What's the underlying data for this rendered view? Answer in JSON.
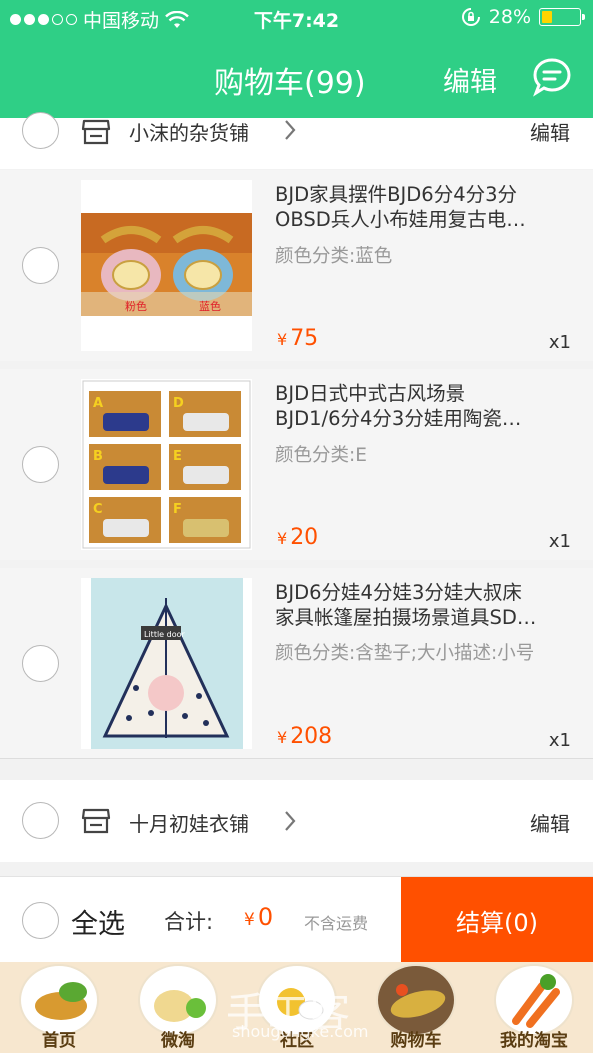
{
  "status": {
    "carrier": "中国移动",
    "time": "下午7:42",
    "battery": "28%",
    "battery_level": 0.28,
    "signal_full": 3,
    "signal_total": 5
  },
  "nav": {
    "title": "购物车(99)",
    "edit": "编辑",
    "message_icon": "chat-bubble-icon"
  },
  "colors": {
    "brand": "#2fcf86",
    "price": "#ff5000",
    "checkout": "#ff5000"
  },
  "shops": [
    {
      "name": "小沫的杂货铺",
      "edit": "编辑",
      "items": [
        {
          "title_line1": "BJD家具摆件BJD6分4分3分",
          "title_line2": "OBSD兵人小布娃用复古电…",
          "spec": "颜色分类:蓝色",
          "price": "75",
          "qty": "x1",
          "image_labels": [
            "粉色",
            "蓝色"
          ]
        },
        {
          "title_line1": "BJD日式中式古风场景",
          "title_line2": "BJD1/6分4分3分娃用陶瓷…",
          "spec": "颜色分类:E",
          "price": "20",
          "qty": "x1",
          "image_labels": [
            "A",
            "D",
            "B",
            "E",
            "C",
            "F"
          ]
        },
        {
          "title_line1": "BJD6分娃4分娃3分娃大叔床",
          "title_line2": "家具帐篷屋拍摄场景道具SD…",
          "spec": "颜色分类:含垫子;大小描述:小号",
          "price": "208",
          "qty": "x1",
          "image_labels": [
            "Little door"
          ]
        }
      ]
    },
    {
      "name": "十月初娃衣铺",
      "edit": "编辑"
    }
  ],
  "footer": {
    "select_all": "全选",
    "total_label": "合计:",
    "currency": "¥",
    "total": "0",
    "shipping": "不含运费",
    "checkout": "结算(0)"
  },
  "tabs": [
    {
      "label": "首页",
      "icon": "home-food-icon"
    },
    {
      "label": "微淘",
      "icon": "weitao-food-icon"
    },
    {
      "label": "社区",
      "icon": "community-food-icon"
    },
    {
      "label": "购物车",
      "icon": "cart-food-icon"
    },
    {
      "label": "我的淘宝",
      "icon": "profile-food-icon"
    }
  ],
  "watermark": {
    "main": "手工客",
    "sub": "shougongke.com"
  }
}
